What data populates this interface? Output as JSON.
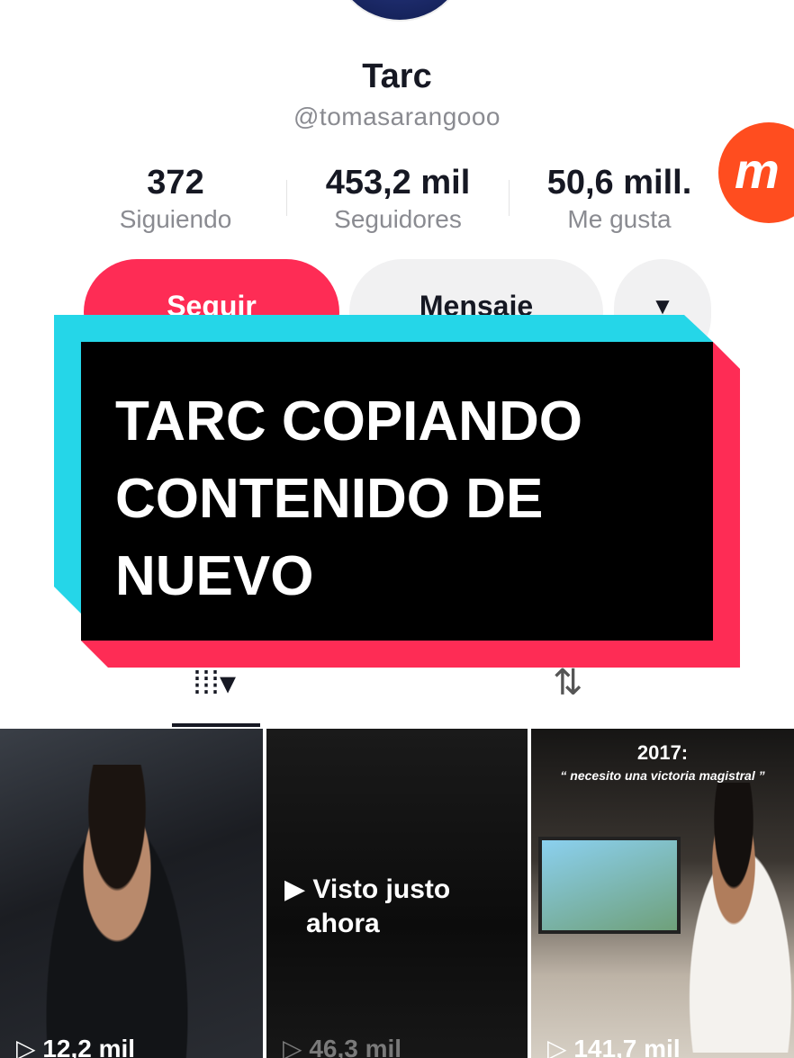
{
  "profile": {
    "name": "Tarc",
    "handle": "@tomasarangooo"
  },
  "stats": [
    {
      "value": "372",
      "label": "Siguiendo"
    },
    {
      "value": "453,2 mil",
      "label": "Seguidores"
    },
    {
      "value": "50,6 mill.",
      "label": "Me gusta"
    }
  ],
  "badge": {
    "letter": "m",
    "color": "#ff4d1f"
  },
  "actions": {
    "follow_label": "Seguir",
    "message_label": "Mensaje",
    "more_label": "▼"
  },
  "overlay": {
    "line1": "TARC COPIANDO",
    "line2": "CONTENIDO DE",
    "line3": "NUEVO",
    "colors": {
      "cyan": "#25d6e8",
      "red": "#fe2c55",
      "box": "#000000"
    }
  },
  "tabs": {
    "videos_icon": "grid-icon",
    "videos_glyph": "⁞⁞⁞▾",
    "reposts_icon": "repost-icon",
    "reposts_glyph": "⇅"
  },
  "videos": [
    {
      "views": "▷ 12,2 mil"
    },
    {
      "views": "▷ 46,3 mil",
      "seen_line1": "▶ Visto justo",
      "seen_line2": "ahora"
    },
    {
      "views": "▷ 141,7 mil",
      "caption_year": "2017:",
      "caption_quote": "“ necesito una victoria magistral ”"
    }
  ],
  "theme": {
    "accent": "#fe2c55",
    "text": "#161823",
    "muted": "#8a8b91"
  }
}
